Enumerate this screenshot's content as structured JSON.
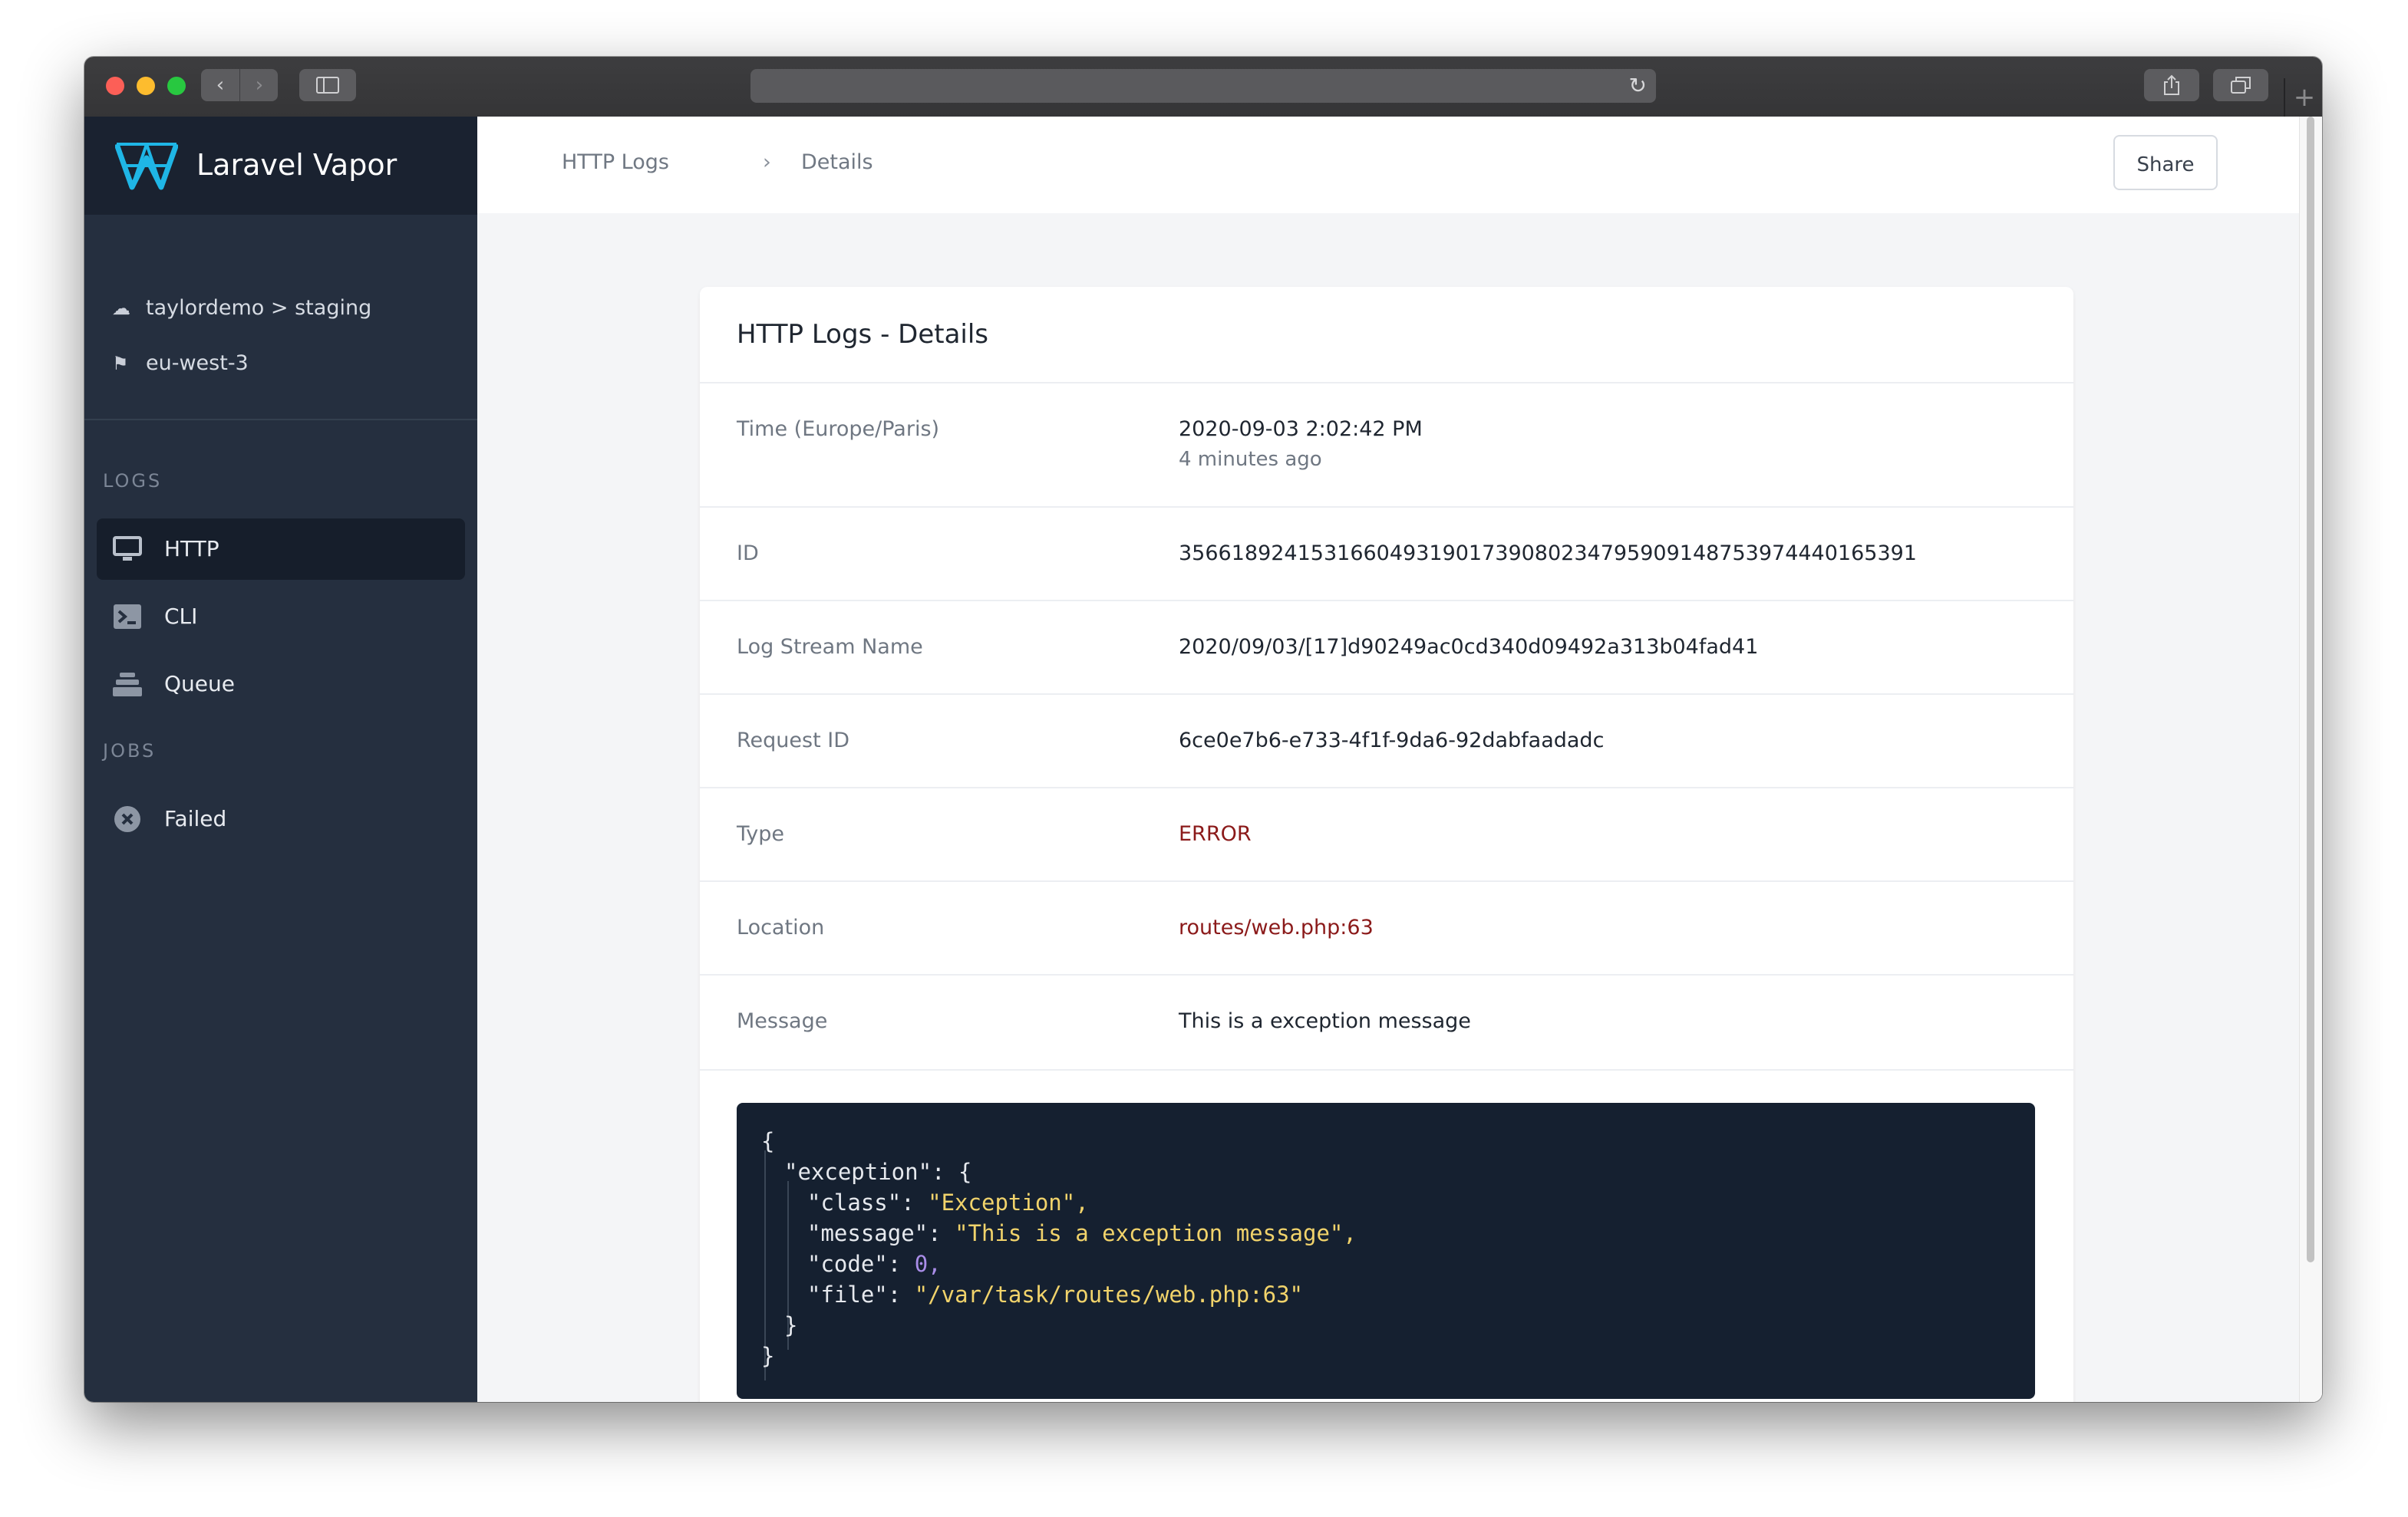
{
  "browser": {
    "back_icon": "chevron-left-icon",
    "forward_icon": "chevron-right-icon",
    "sidebar_icon": "sidebar-toggle-icon",
    "reload_icon": "reload-icon",
    "share_icon": "share-icon",
    "tabs_icon": "tabs-icon",
    "new_tab_icon": "plus-icon"
  },
  "sidebar": {
    "brand": "Laravel Vapor",
    "project": "taylordemo > staging",
    "region": "eu-west-3",
    "sections": [
      {
        "title": "LOGS",
        "items": [
          {
            "label": "HTTP",
            "icon": "monitor-icon",
            "active": true
          },
          {
            "label": "CLI",
            "icon": "terminal-icon",
            "active": false
          },
          {
            "label": "Queue",
            "icon": "layers-icon",
            "active": false
          }
        ]
      },
      {
        "title": "JOBS",
        "items": [
          {
            "label": "Failed",
            "icon": "x-circle-icon",
            "active": false
          }
        ]
      }
    ]
  },
  "header": {
    "breadcrumb": [
      "HTTP Logs",
      "Details"
    ],
    "share_label": "Share"
  },
  "details": {
    "title": "HTTP Logs - Details",
    "rows": [
      {
        "key": "Time (Europe/Paris)",
        "value": "2020-09-03 2:02:42 PM",
        "sub": "4 minutes ago"
      },
      {
        "key": "ID",
        "value": "35661892415316604931901739080234795909148753974440165391"
      },
      {
        "key": "Log Stream Name",
        "value": "2020/09/03/[17]d90249ac0cd340d09492a313b04fad41"
      },
      {
        "key": "Request ID",
        "value": "6ce0e7b6-e733-4f1f-9da6-92dabfaadadc"
      },
      {
        "key": "Type",
        "value": "ERROR"
      },
      {
        "key": "Location",
        "value": "routes/web.php:63"
      },
      {
        "key": "Message",
        "value": "This is a exception message"
      }
    ],
    "json": {
      "open": "{",
      "exception_key": "\"exception\": {",
      "class_key": "\"class\": ",
      "class_val": "\"Exception\",",
      "message_key": "\"message\": ",
      "message_val": "\"This is a exception message\",",
      "code_key": "\"code\": ",
      "code_val": "0,",
      "file_key": "\"file\": ",
      "file_val": "\"/var/task/routes/web.php:63\"",
      "inner_close": "}",
      "close": "}"
    }
  },
  "colors": {
    "sidebar_bg": "#252f3f",
    "brand_bg": "#1a2230",
    "accent_logo": "#1fb6e6",
    "error_red": "#8b1a1a",
    "code_bg": "#152030",
    "json_string": "#f1d36b",
    "json_number": "#a98de8"
  }
}
